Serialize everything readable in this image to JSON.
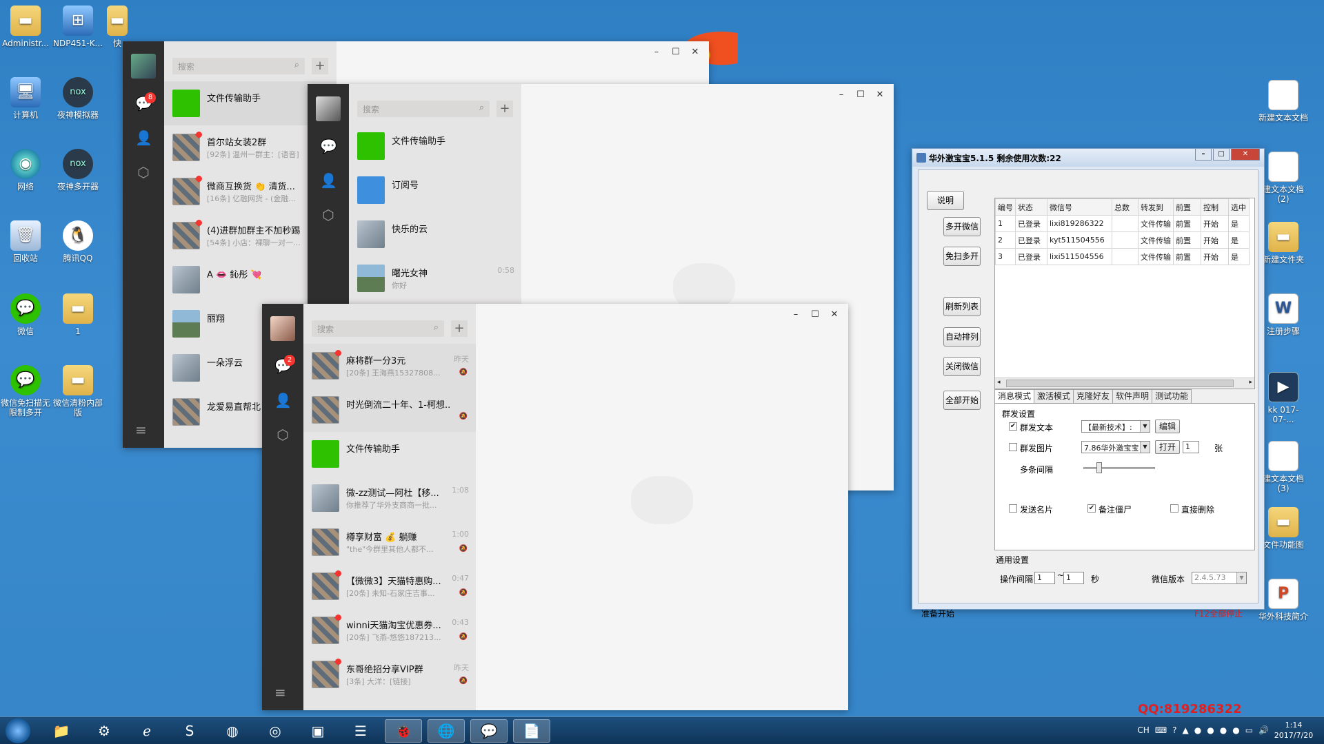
{
  "desktop": {
    "left_icons": [
      {
        "label": "Administr..."
      },
      {
        "label": "NDP451-K..."
      },
      {
        "label": "快"
      },
      {
        "label": "计算机"
      },
      {
        "label": "夜神模拟器"
      },
      {
        "label": "网络"
      },
      {
        "label": "夜神多开器"
      },
      {
        "label": "回收站"
      },
      {
        "label": "腾讯QQ"
      },
      {
        "label": "微信"
      },
      {
        "label": "1"
      },
      {
        "label": "微信免扫描无限制多开"
      },
      {
        "label": "微信清粉内部版"
      }
    ],
    "right_icons": [
      {
        "label": "新建文本文档"
      },
      {
        "label": "建文本文档(2)"
      },
      {
        "label": "新建文件夹"
      },
      {
        "label": "注册步骤"
      },
      {
        "label": "kk 017-07-..."
      },
      {
        "label": "建文本文档(3)"
      },
      {
        "label": "文件功能图"
      },
      {
        "label": "华外科技简介"
      }
    ]
  },
  "wechat": {
    "search_placeholder": "搜索",
    "win1": {
      "badge": "8",
      "items": [
        {
          "name": "文件传输助手",
          "sub": "",
          "time": ""
        },
        {
          "name": "首尔站女装2群",
          "sub": "[92条] 温州一群主：[语音]",
          "time": ""
        },
        {
          "name": "微商互换货 👏 清货...",
          "sub": "[16条] 亿融网货 - (金融...",
          "time": ""
        },
        {
          "name": "(4)进群加群主不加秒踢",
          "sub": "[54条] 小店：裸聊一对一...",
          "time": ""
        },
        {
          "name": "A 👄 鈊彤 💘",
          "sub": "",
          "time": ""
        },
        {
          "name": "丽翔",
          "sub": "",
          "time": ""
        },
        {
          "name": "一朵浮云",
          "sub": "",
          "time": ""
        },
        {
          "name": "龙爱易直帮北",
          "sub": "",
          "time": ""
        }
      ]
    },
    "win2": {
      "items": [
        {
          "name": "文件传输助手",
          "sub": "",
          "time": ""
        },
        {
          "name": "订阅号",
          "sub": "",
          "time": ""
        },
        {
          "name": "快乐的云",
          "sub": "",
          "time": ""
        },
        {
          "name": "曙光女神",
          "sub": "你好",
          "time": "0:58"
        }
      ]
    },
    "win3": {
      "badge": "2",
      "items": [
        {
          "name": "麻将群一分3元",
          "sub": "[20条] 王海燕15327808...",
          "time": "昨天"
        },
        {
          "name": "时光倒流二十年、1-柯想...",
          "sub": "",
          "time": ""
        },
        {
          "name": "文件传输助手",
          "sub": "",
          "time": ""
        },
        {
          "name": "微-zz测试—阿杜【移...",
          "sub": "你推荐了华外支商商一批...",
          "time": "1:08"
        },
        {
          "name": "樽享财富 💰 躺赚",
          "sub": "\"the\"今群里其他人都不...",
          "time": "1:00"
        },
        {
          "name": "【微微3】天猫特惠购...",
          "sub": "[20条] 未知-石家庄吉事...",
          "time": "0:47"
        },
        {
          "name": "winni天猫淘宝优惠券...",
          "sub": "[20条] 飞燕-悠悠187213...",
          "time": "0:43"
        },
        {
          "name": "东哥绝招分享VIP群",
          "sub": "[3条] 大洋：[链接]",
          "time": "昨天"
        }
      ]
    }
  },
  "tool": {
    "title": "华外激宝宝5.1.5    剩余使用次数:22",
    "side_buttons": [
      "说明",
      "多开微信",
      "免扫多开",
      "刷新列表",
      "自动排列",
      "关闭微信",
      "全部开始"
    ],
    "columns": [
      "编号",
      "状态",
      "微信号",
      "总数",
      "转发到",
      "前置",
      "控制",
      "选中"
    ],
    "rows": [
      [
        "1",
        "已登录",
        "lixi819286322",
        "",
        "文件传输",
        "前置",
        "开始",
        "是"
      ],
      [
        "2",
        "已登录",
        "kyt511504556",
        "",
        "文件传输",
        "前置",
        "开始",
        "是"
      ],
      [
        "3",
        "已登录",
        "lixi511504556",
        "",
        "文件传输",
        "前置",
        "开始",
        "是"
      ]
    ],
    "tabs": [
      "消息模式",
      "激活模式",
      "克隆好友",
      "软件声明",
      "测试功能"
    ],
    "group_title": "群发设置",
    "send_text": {
      "label": "群发文本",
      "checked": true,
      "combo": "【最新技术】:",
      "button": "编辑"
    },
    "send_image": {
      "label": "群发图片",
      "checked": false,
      "combo": "7.86华外激宝宝",
      "button": "打开",
      "count": "1",
      "unit": "张"
    },
    "interval_label": "多条间隔",
    "send_card": {
      "label": "发送名片",
      "checked": false
    },
    "note_zombie": {
      "label": "备注僵尸",
      "checked": true
    },
    "direct_delete": {
      "label": "直接删除",
      "checked": false
    },
    "general_title": "通用设置",
    "op_interval_label": "操作间隔",
    "op_interval_from": "1",
    "op_interval_tilde": "~",
    "op_interval_to": "1",
    "op_interval_unit": "秒",
    "version_label": "微信版本",
    "version_value": "2.4.5.73",
    "status_left": "准备开始",
    "status_right": "F12全部停止"
  },
  "taskbar": {
    "tray_lang": "CH",
    "time": "1:14",
    "date": "2017/7/20"
  },
  "watermark": "QQ:819286322"
}
